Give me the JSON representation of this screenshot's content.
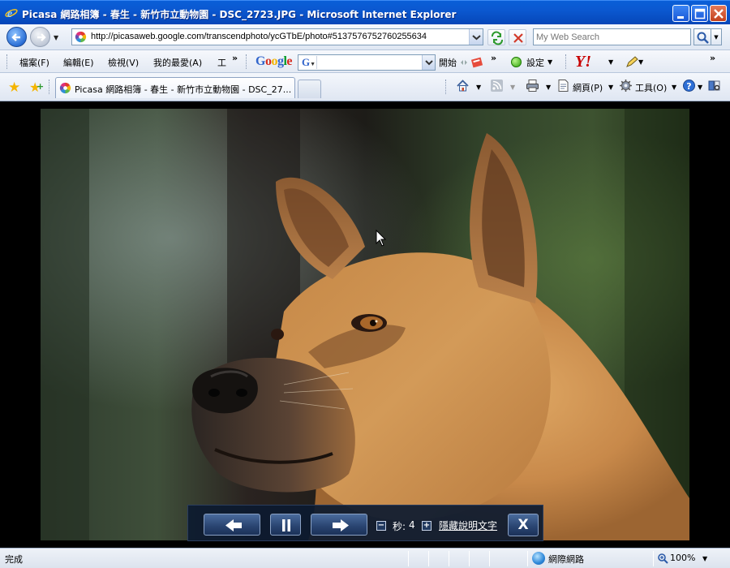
{
  "window": {
    "title": "Picasa 網路相簿 - 春生 - 新竹市立動物園 - DSC_2723.JPG - Microsoft Internet Explorer"
  },
  "address_bar": {
    "url": "http://picasaweb.google.com/transcendphoto/ycGTbE/photo#5137576752760255634"
  },
  "search": {
    "placeholder": "My Web Search"
  },
  "menu": {
    "items": [
      "檔案(F)",
      "編輯(E)",
      "檢視(V)",
      "我的最愛(A)",
      "工"
    ]
  },
  "google_toolbar": {
    "logo": "Google",
    "start_label": "開始",
    "settings_label": "設定"
  },
  "tab": {
    "label": "Picasa 網路相簿 - 春生 - 新竹市立動物園 - DSC_27..."
  },
  "command_bar": {
    "page_label": "網頁(P)",
    "tools_label": "工具(O)"
  },
  "slideshow": {
    "seconds_label": "秒:",
    "seconds_value": "4",
    "hide_caption_label": "隱藏說明文字",
    "close_label": "X"
  },
  "status": {
    "text": "完成",
    "zone": "網際網路",
    "zoom": "100%"
  },
  "colors": {
    "titlebar": "#0b58d0",
    "slideshow_panel": "#0c1a30"
  }
}
